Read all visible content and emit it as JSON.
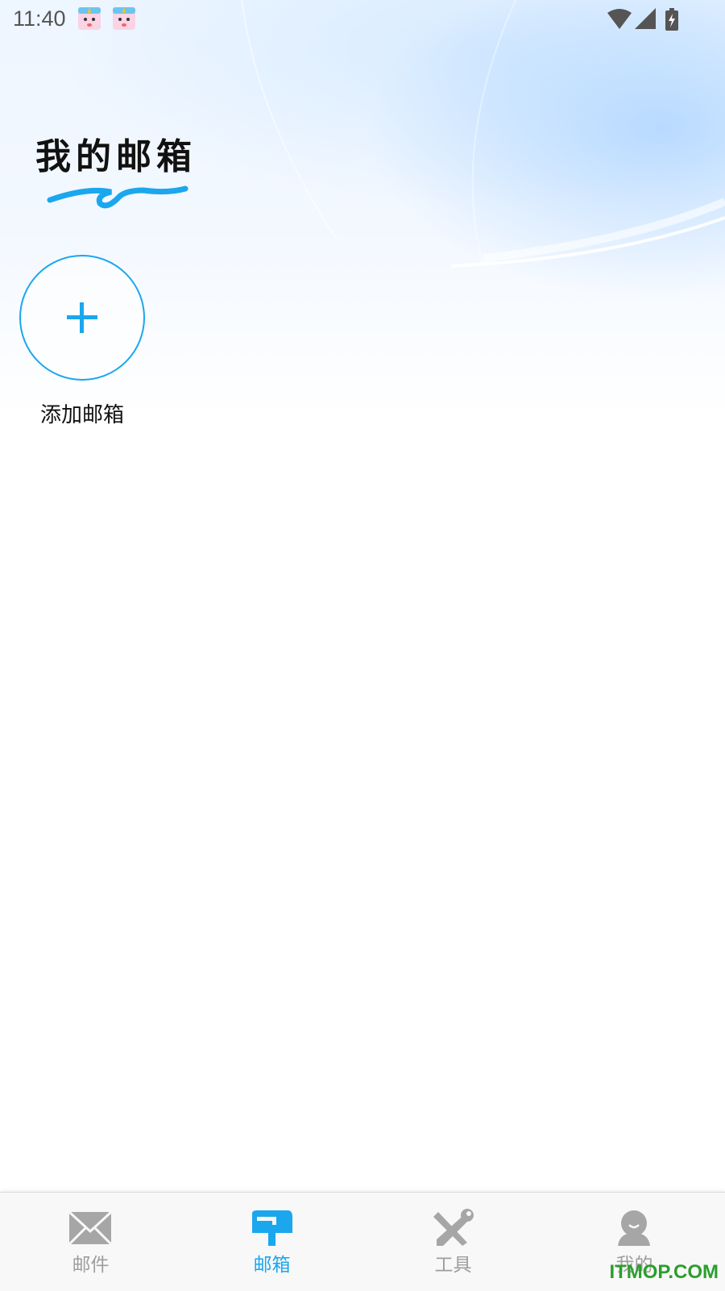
{
  "status_bar": {
    "time": "11:40",
    "notification_icons": [
      "unicorn-app-icon",
      "unicorn-app-icon"
    ],
    "right_icons": [
      "wifi-icon",
      "cell-signal-icon",
      "battery-charging-icon"
    ]
  },
  "header": {
    "title": "我的邮箱"
  },
  "add_mailbox": {
    "icon": "plus-icon",
    "label": "添加邮箱"
  },
  "tab_bar": {
    "tabs": [
      {
        "label": "邮件",
        "icon": "envelope-icon",
        "active": false
      },
      {
        "label": "邮箱",
        "icon": "mailbox-icon",
        "active": true
      },
      {
        "label": "工具",
        "icon": "tools-icon",
        "active": false
      },
      {
        "label": "我的",
        "icon": "person-icon",
        "active": false
      }
    ]
  },
  "watermark": "ITMOP.COM",
  "colors": {
    "accent": "#1aa7ee",
    "inactive": "#9e9e9e",
    "title": "#111111"
  }
}
